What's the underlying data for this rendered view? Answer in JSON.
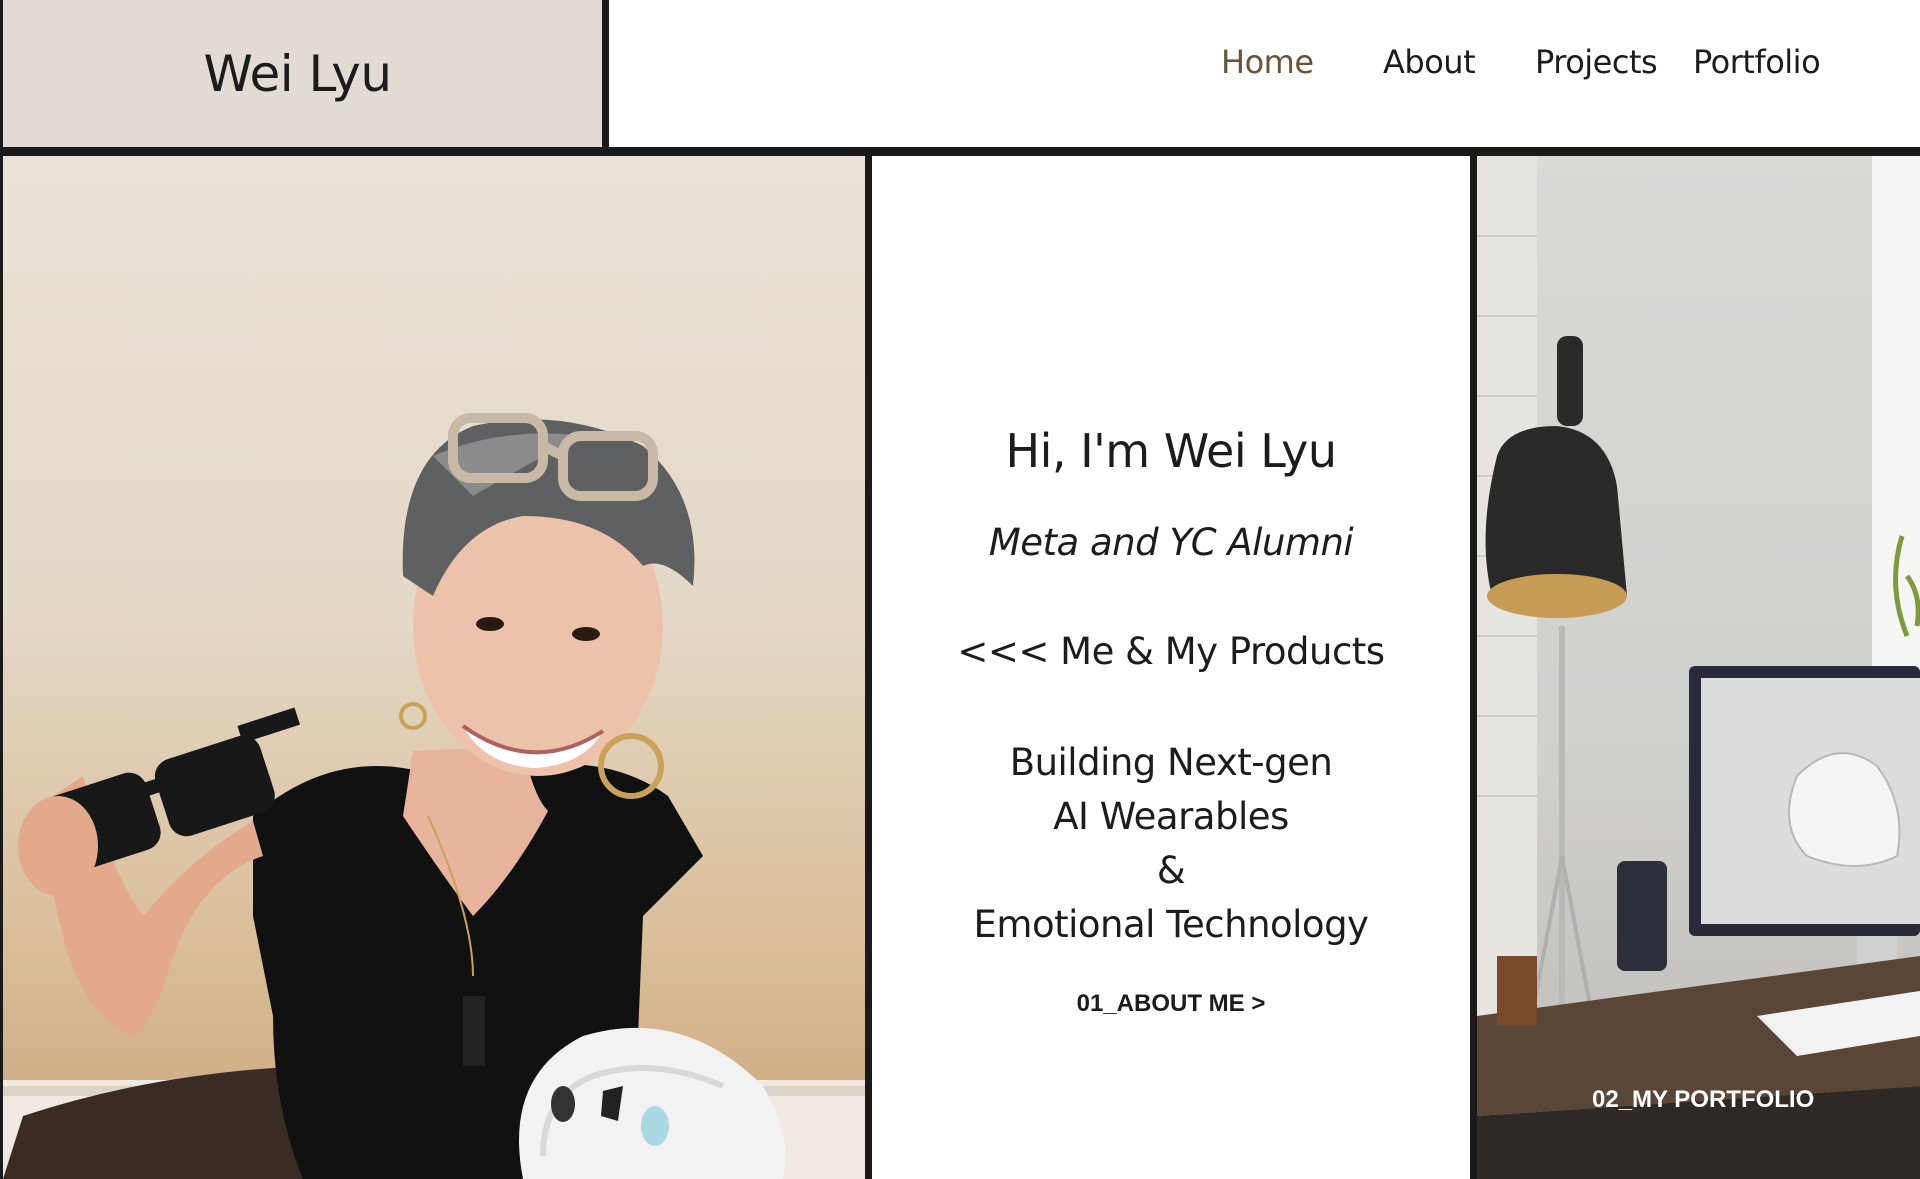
{
  "header": {
    "logo": "Wei Lyu",
    "nav": [
      {
        "label": "Home",
        "active": true
      },
      {
        "label": "About",
        "active": false
      },
      {
        "label": "Projects",
        "active": false
      },
      {
        "label": "Portfolio",
        "active": false
      }
    ]
  },
  "hero": {
    "title": "Hi, I'm Wei Lyu",
    "subtitle": "Meta and YC Alumni",
    "products_line": "<<< Me & My Products",
    "mission": [
      "Building Next-gen",
      "AI Wearables",
      "&",
      "Emotional Technology"
    ],
    "about_link": "01_ABOUT ME >"
  },
  "portfolio_panel": {
    "link": "02_MY PORTFOLIO"
  },
  "colors": {
    "logo_bg": "#e1dbd4",
    "active_nav": "#6b5338",
    "border": "#1a1a1a"
  }
}
